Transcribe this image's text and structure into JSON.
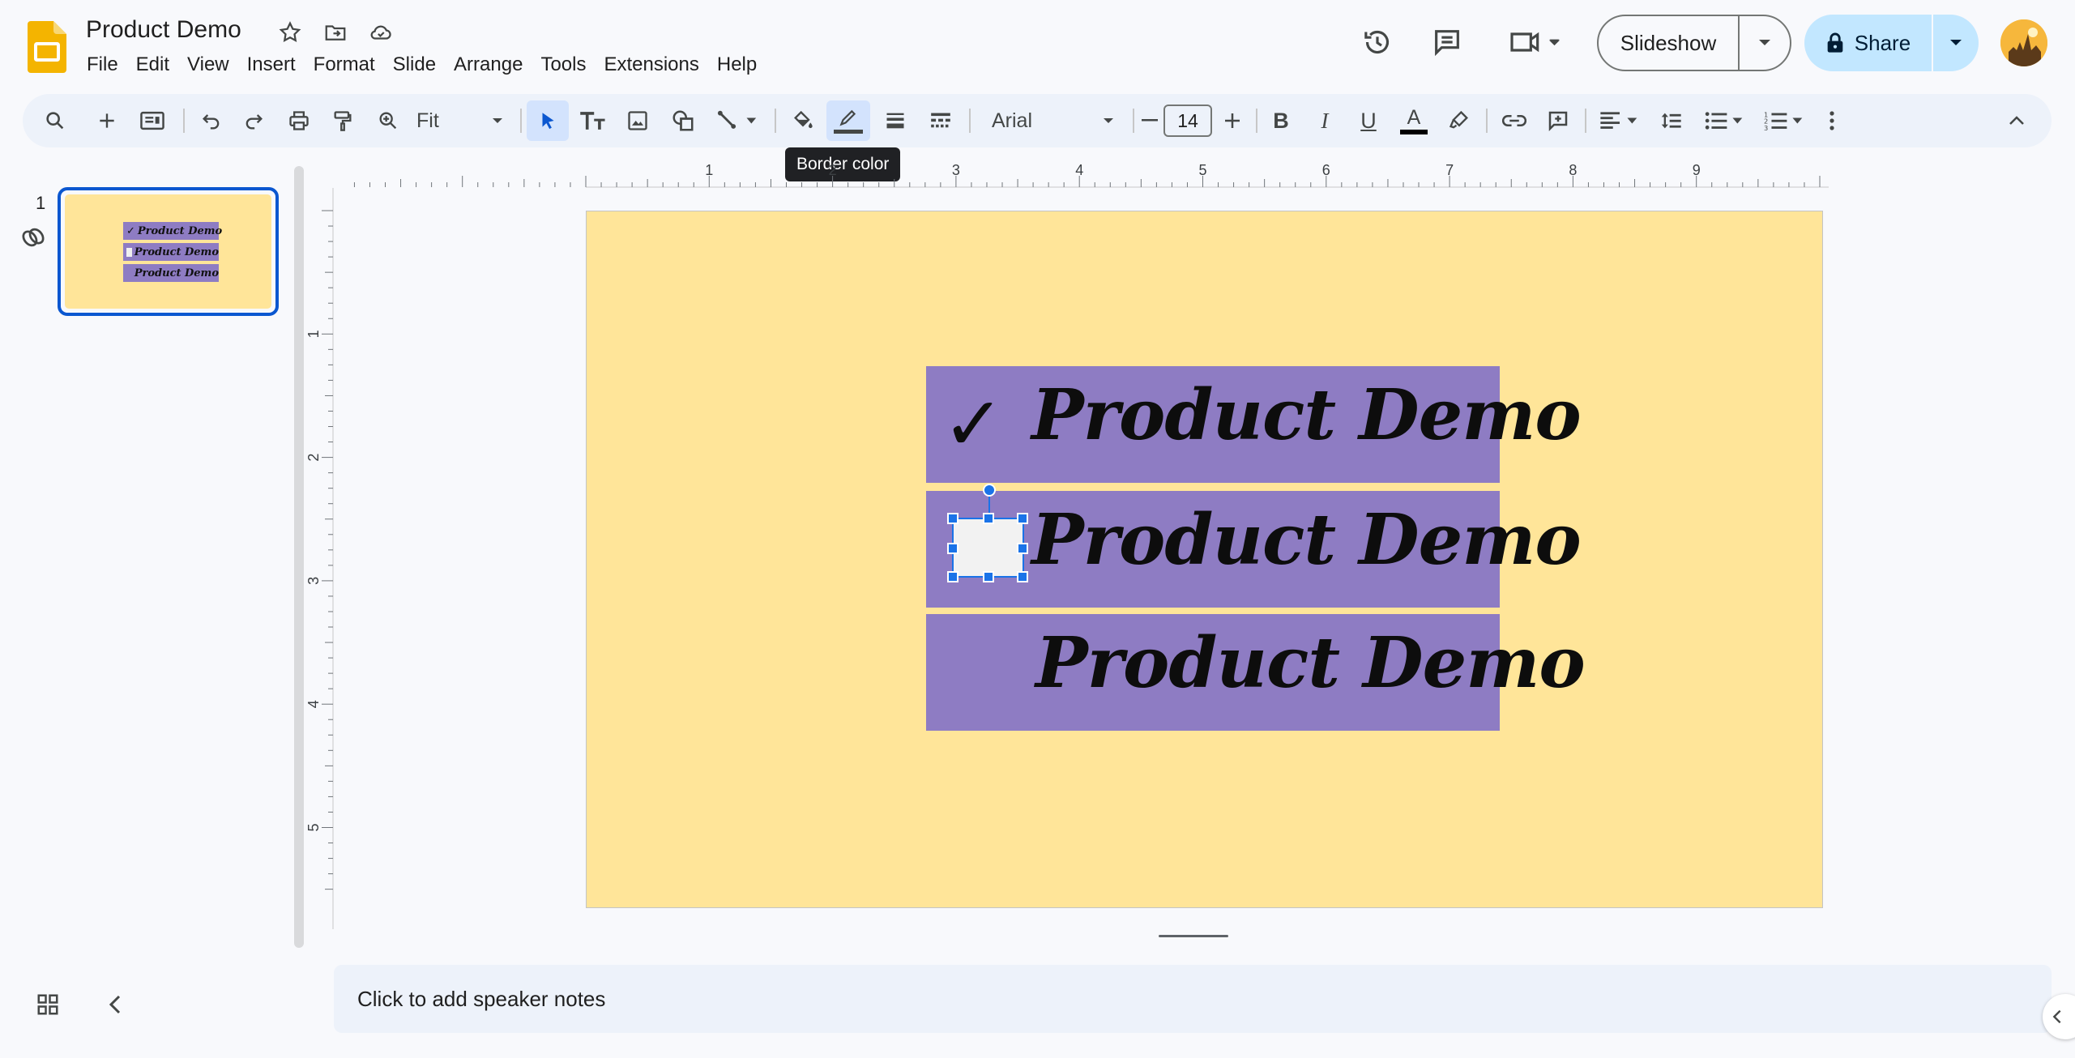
{
  "app": {
    "doc_title": "Product Demo",
    "menu": [
      "File",
      "Edit",
      "View",
      "Insert",
      "Format",
      "Slide",
      "Arrange",
      "Tools",
      "Extensions",
      "Help"
    ],
    "icons": {
      "star": "star-icon",
      "move": "move-to-folder-icon",
      "cloud": "cloud-saved-icon"
    }
  },
  "header": {
    "slideshow_label": "Slideshow",
    "share_label": "Share",
    "icons": [
      "version-history-icon",
      "comments-icon",
      "meet-camera-icon",
      "avatar"
    ]
  },
  "toolbar": {
    "zoom_label": "Fit",
    "font_name": "Arial",
    "font_size": "14",
    "tooltip": "Border color",
    "active_tool": "select"
  },
  "filmstrip": {
    "slide_number": "1",
    "thumb_rows": [
      "Product Demo",
      "Product Demo",
      "Product Demo"
    ]
  },
  "rulers": {
    "horizontal_ticks": [
      "1",
      "2",
      "3",
      "4",
      "5",
      "6",
      "7",
      "8",
      "9"
    ],
    "vertical_ticks": [
      "1",
      "2",
      "3",
      "4",
      "5"
    ]
  },
  "slide": {
    "background_color": "#ffe599",
    "box_color": "#8e7cc3",
    "rows": [
      {
        "marker": "check",
        "glyph": "✓",
        "text": "Product Demo"
      },
      {
        "marker": "selected-checkbox",
        "glyph": "",
        "text": "Product Demo"
      },
      {
        "marker": "none",
        "glyph": "",
        "text": "Product Demo"
      }
    ]
  },
  "notes": {
    "placeholder": "Click to add speaker notes"
  },
  "colors": {
    "accent": "#0b57d0",
    "share_bg": "#c2e7ff",
    "toolbar_bg": "#edf2fa",
    "selection": "#1a73e8"
  }
}
